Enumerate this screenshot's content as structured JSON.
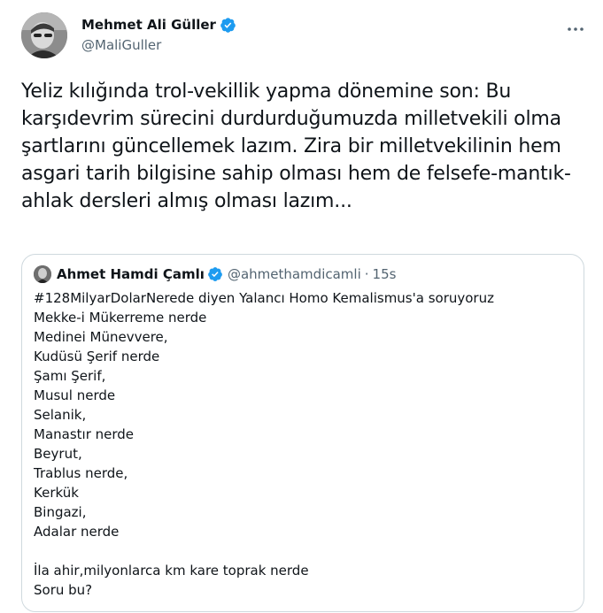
{
  "tweet": {
    "author": {
      "name": "Mehmet Ali Güller",
      "handle": "@MaliGuller",
      "verified": true
    },
    "text": "Yeliz kılığında trol-vekillik yapma dönemine son: Bu karşıdevrim sürecini durdurduğumuzda milletvekili olma şartlarını güncellemek lazım. Zira bir milletvekilinin hem asgari tarih bilgisine sahip olması hem de felsefe-mantık-ahlak dersleri almış olması lazım..."
  },
  "quote": {
    "author": {
      "name": "Ahmet Hamdi Çamlı",
      "handle": "@ahmethamdicamli",
      "verified": true
    },
    "separator": "·",
    "time": "15s",
    "text": "#128MilyarDolarNerede diyen Yalancı Homo Kemalismus'a soruyoruz\nMekke-i Mükerreme nerde\nMedinei Münevvere,\nKudüsü Şerif nerde\nŞamı Şerif,\nMusul nerde\nSelanik,\nManastır nerde\nBeyrut,\nTrablus nerde,\nKerkük\nBingazi,\nAdalar nerde\n\nİla ahir,milyonlarca km kare toprak nerde\nSoru bu?"
  },
  "colors": {
    "verified_badge": "#1d9bf0",
    "secondary_text": "#536471",
    "border": "#cfd9de"
  },
  "icons": {
    "verified": "verified-badge-icon",
    "more": "more-horizontal-icon"
  }
}
